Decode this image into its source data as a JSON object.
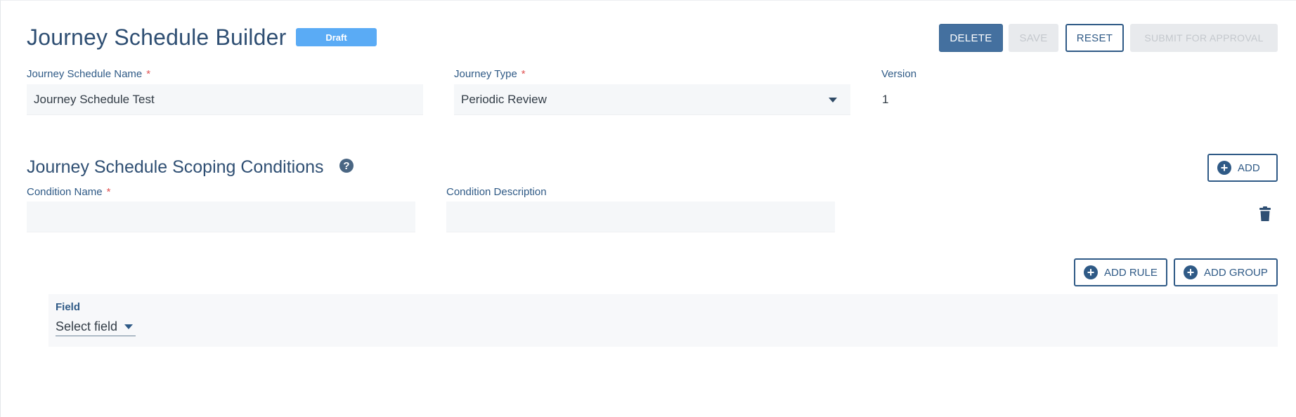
{
  "header": {
    "title": "Journey Schedule Builder",
    "status_badge": "Draft",
    "buttons": {
      "delete": "DELETE",
      "save": "SAVE",
      "reset": "RESET",
      "submit": "SUBMIT FOR APPROVAL"
    }
  },
  "form": {
    "name_label": "Journey Schedule Name",
    "name_value": "Journey Schedule Test",
    "type_label": "Journey Type",
    "type_value": "Periodic Review",
    "version_label": "Version",
    "version_value": "1",
    "required_mark": "*"
  },
  "scoping": {
    "title": "Journey Schedule Scoping Conditions",
    "help_glyph": "?",
    "add_label": "ADD",
    "condition_name_label": "Condition Name",
    "condition_name_value": "",
    "condition_description_label": "Condition Description",
    "condition_description_value": "",
    "add_rule_label": "ADD RULE",
    "add_group_label": "ADD GROUP",
    "rule": {
      "field_label": "Field",
      "field_value": "Select field"
    }
  },
  "icons": {
    "help": "question-circle-icon",
    "plus": "plus-circle-icon",
    "delete": "trash-icon",
    "dropdown": "caret-down-icon"
  },
  "colors": {
    "primary": "#44709f",
    "badge": "#5aabf5",
    "required": "#e05252",
    "disabled": "#e8eaed"
  }
}
